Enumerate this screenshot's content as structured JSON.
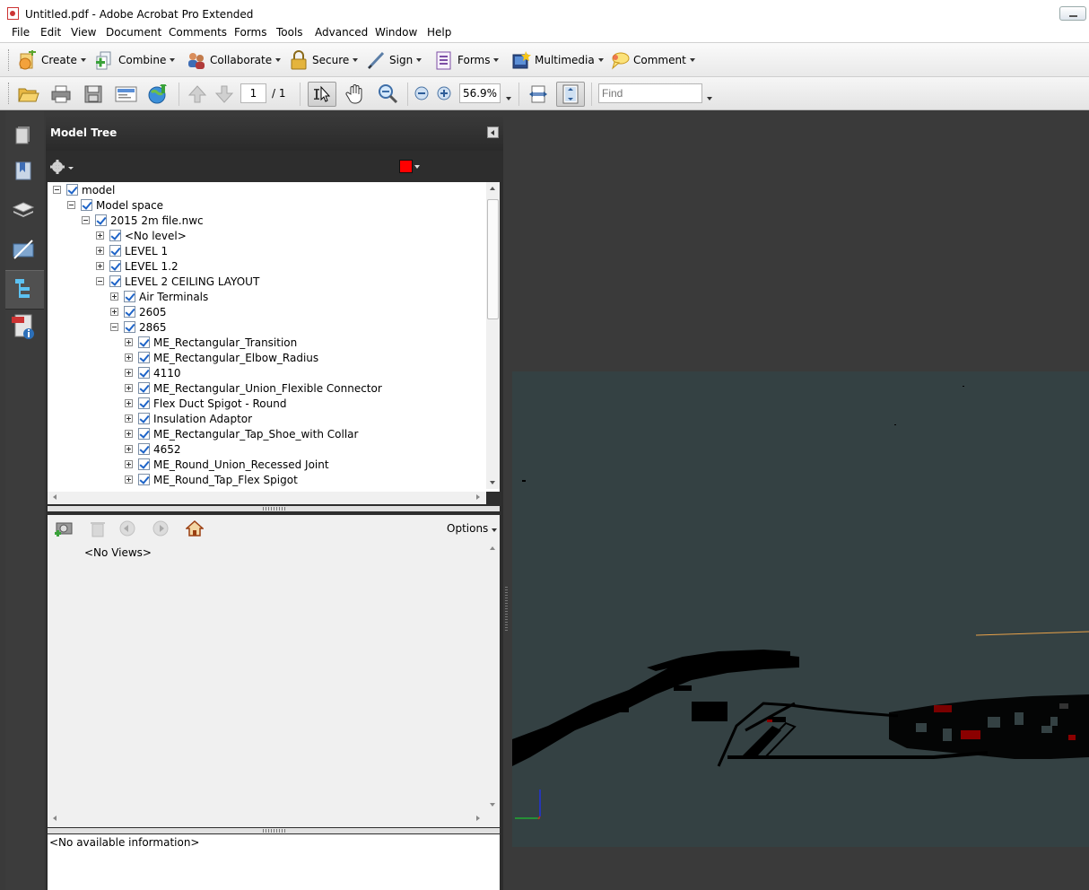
{
  "window": {
    "title": "Untitled.pdf - Adobe Acrobat Pro Extended"
  },
  "menu": [
    "File",
    "Edit",
    "View",
    "Document",
    "Comments",
    "Forms",
    "Tools",
    "Advanced",
    "Window",
    "Help"
  ],
  "toolbar1": {
    "create": "Create",
    "combine": "Combine",
    "collaborate": "Collaborate",
    "secure": "Secure",
    "sign": "Sign",
    "forms": "Forms",
    "multimedia": "Multimedia",
    "comment": "Comment"
  },
  "toolbar2": {
    "page_current": "1",
    "page_total": "/ 1",
    "zoom": "56.9%",
    "find_placeholder": "Find"
  },
  "panel": {
    "title": "Model Tree",
    "tree": [
      {
        "label": "model",
        "expander": "minus"
      },
      {
        "label": "Model space",
        "expander": "minus"
      },
      {
        "label": "2015 2m file.nwc",
        "expander": "minus"
      },
      {
        "label": "<No level>",
        "expander": "plus"
      },
      {
        "label": "LEVEL 1",
        "expander": "plus"
      },
      {
        "label": "LEVEL 1.2",
        "expander": "plus"
      },
      {
        "label": "LEVEL 2 CEILING LAYOUT",
        "expander": "minus"
      },
      {
        "label": "Air Terminals",
        "expander": "plus"
      },
      {
        "label": "2605",
        "expander": "plus"
      },
      {
        "label": "2865",
        "expander": "minus"
      },
      {
        "label": "ME_Rectangular_Transition",
        "expander": "plus"
      },
      {
        "label": "ME_Rectangular_Elbow_Radius",
        "expander": "plus"
      },
      {
        "label": "4110",
        "expander": "plus"
      },
      {
        "label": "ME_Rectangular_Union_Flexible Connector",
        "expander": "plus"
      },
      {
        "label": "Flex Duct Spigot - Round",
        "expander": "plus"
      },
      {
        "label": "Insulation Adaptor",
        "expander": "plus"
      },
      {
        "label": "ME_Rectangular_Tap_Shoe_with Collar",
        "expander": "plus"
      },
      {
        "label": "4652",
        "expander": "plus"
      },
      {
        "label": "ME_Round_Union_Recessed Joint",
        "expander": "plus"
      },
      {
        "label": "ME_Round_Tap_Flex Spigot",
        "expander": "plus"
      }
    ],
    "views_options": "Options",
    "no_views": "<No Views>",
    "info": "<No available information>"
  },
  "colors": {
    "highlight_swatch": "#ff0000",
    "canvas_bg": "#344143",
    "panel_bg": "#2d2d2d"
  }
}
